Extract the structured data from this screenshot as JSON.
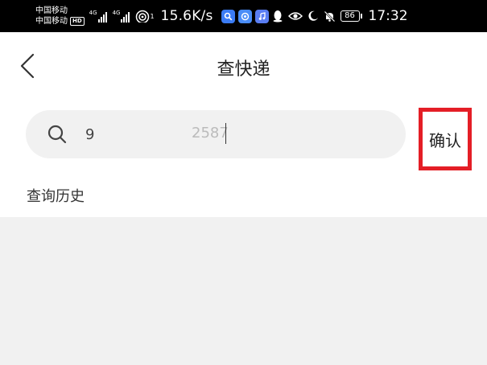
{
  "status_bar": {
    "carrier_1": "中国移动",
    "carrier_2": "中国移动",
    "hd_badge": "HD",
    "signal_1_tag": "4G",
    "signal_2_tag": "4G",
    "wifi_superscript": "1",
    "net_speed": "15.6K/s",
    "app_icons": [
      "search-app-icon",
      "browser-app-icon",
      "music-app-icon",
      "qq-icon"
    ],
    "battery_level": "86",
    "time": "17:32"
  },
  "header": {
    "title": "查快递"
  },
  "search": {
    "value": "9",
    "value_tail": "2587"
  },
  "confirm": {
    "label": "确认"
  },
  "history": {
    "label": "查询历史"
  },
  "colors": {
    "accent_highlight": "#e41e26",
    "page_background": "#f1f1f1",
    "search_background": "#f1f1f1"
  }
}
